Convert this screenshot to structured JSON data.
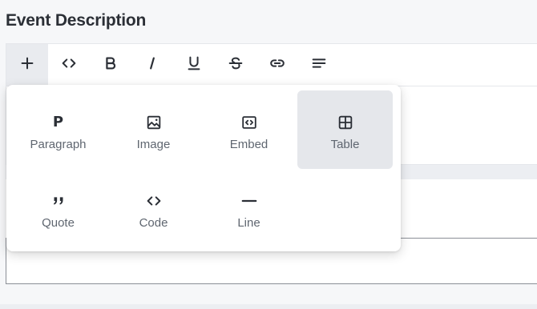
{
  "section": {
    "title": "Event Description"
  },
  "toolbar": {
    "buttons": [
      {
        "name": "add",
        "icon": "plus-icon"
      },
      {
        "name": "code",
        "icon": "code-icon"
      },
      {
        "name": "bold",
        "icon": "bold-icon"
      },
      {
        "name": "italic",
        "icon": "italic-icon"
      },
      {
        "name": "underline",
        "icon": "underline-icon"
      },
      {
        "name": "strikethrough",
        "icon": "strikethrough-icon"
      },
      {
        "name": "link",
        "icon": "link-icon"
      },
      {
        "name": "align",
        "icon": "align-left-icon"
      }
    ]
  },
  "insert_menu": {
    "items": [
      {
        "label": "Paragraph",
        "icon": "paragraph-icon"
      },
      {
        "label": "Image",
        "icon": "image-icon"
      },
      {
        "label": "Embed",
        "icon": "embed-icon"
      },
      {
        "label": "Table",
        "icon": "table-icon",
        "selected": true
      },
      {
        "label": "Quote",
        "icon": "quote-icon"
      },
      {
        "label": "Code",
        "icon": "code-icon"
      },
      {
        "label": "Line",
        "icon": "horizontal-line-icon"
      }
    ]
  },
  "colors": {
    "text_primary": "#2b2f36",
    "text_muted": "#5f6670",
    "selected_bg": "#e5e7eb",
    "page_bg": "#f6f7f9"
  }
}
